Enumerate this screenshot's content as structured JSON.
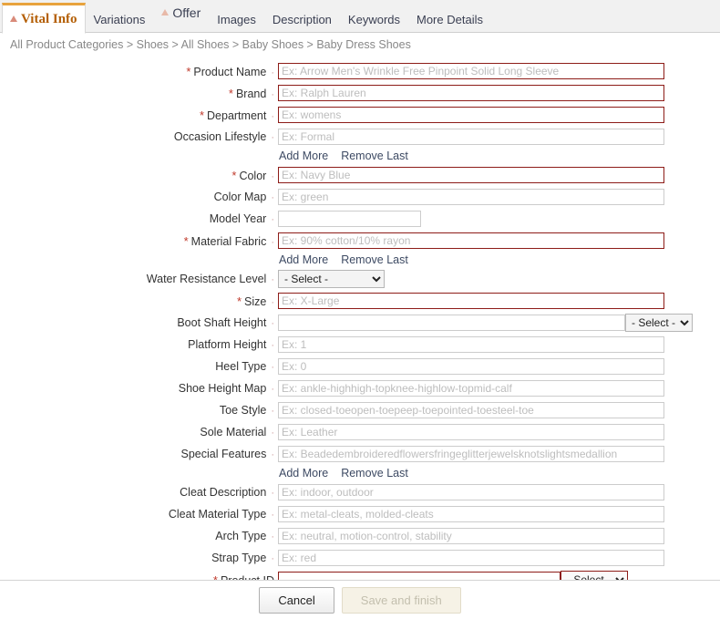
{
  "tabs": [
    {
      "label": "Vital Info",
      "active": true,
      "warning": true
    },
    {
      "label": "Variations",
      "active": false,
      "warning": false
    },
    {
      "label": "Offer",
      "active": false,
      "warning": true,
      "raised": true
    },
    {
      "label": "Images",
      "active": false,
      "warning": false
    },
    {
      "label": "Description",
      "active": false,
      "warning": false
    },
    {
      "label": "Keywords",
      "active": false,
      "warning": false
    },
    {
      "label": "More Details",
      "active": false,
      "warning": false
    }
  ],
  "breadcrumb": "All Product Categories > Shoes > All Shoes > Baby Shoes > Baby Dress Shoes",
  "links": {
    "add_more": "Add More",
    "remove_last": "Remove Last"
  },
  "select_placeholder": "- Select -",
  "fields": {
    "product_name": {
      "label": "Product Name",
      "placeholder": "Ex: Arrow Men's Wrinkle Free Pinpoint Solid Long Sleeve",
      "required": true,
      "value": ""
    },
    "brand": {
      "label": "Brand",
      "placeholder": "Ex: Ralph Lauren",
      "required": true,
      "value": ""
    },
    "department": {
      "label": "Department",
      "placeholder": "Ex: womens",
      "required": true,
      "value": ""
    },
    "occasion_lifestyle": {
      "label": "Occasion Lifestyle",
      "placeholder": "Ex: Formal",
      "required": false,
      "value": ""
    },
    "color": {
      "label": "Color",
      "placeholder": "Ex: Navy Blue",
      "required": true,
      "value": ""
    },
    "color_map": {
      "label": "Color Map",
      "placeholder": "Ex: green",
      "required": false,
      "value": ""
    },
    "model_year": {
      "label": "Model Year",
      "placeholder": "",
      "required": false,
      "value": ""
    },
    "material_fabric": {
      "label": "Material Fabric",
      "placeholder": "Ex: 90% cotton/10% rayon",
      "required": true,
      "value": ""
    },
    "water_resistance": {
      "label": "Water Resistance Level",
      "required": false,
      "value": "- Select -"
    },
    "size": {
      "label": "Size",
      "placeholder": "Ex: X-Large",
      "required": true,
      "value": ""
    },
    "boot_shaft_height": {
      "label": "Boot Shaft Height",
      "placeholder": "",
      "required": false,
      "value": "",
      "unit": "- Select -"
    },
    "platform_height": {
      "label": "Platform Height",
      "placeholder": "Ex: 1",
      "required": false,
      "value": ""
    },
    "heel_type": {
      "label": "Heel Type",
      "placeholder": "Ex: 0",
      "required": false,
      "value": ""
    },
    "shoe_height_map": {
      "label": "Shoe Height Map",
      "placeholder": "Ex: ankle-highhigh-topknee-highlow-topmid-calf",
      "required": false,
      "value": ""
    },
    "toe_style": {
      "label": "Toe Style",
      "placeholder": "Ex: closed-toeopen-toepeep-toepointed-toesteel-toe",
      "required": false,
      "value": ""
    },
    "sole_material": {
      "label": "Sole Material",
      "placeholder": "Ex: Leather",
      "required": false,
      "value": ""
    },
    "special_features": {
      "label": "Special Features",
      "placeholder": "Ex: Beadedembroideredflowersfringeglitterjewelsknotslightsmedallion",
      "required": false,
      "value": ""
    },
    "cleat_description": {
      "label": "Cleat Description",
      "placeholder": "Ex: indoor, outdoor",
      "required": false,
      "value": ""
    },
    "cleat_material": {
      "label": "Cleat Material Type",
      "placeholder": "Ex: metal-cleats, molded-cleats",
      "required": false,
      "value": ""
    },
    "arch_type": {
      "label": "Arch Type",
      "placeholder": "Ex: neutral, motion-control, stability",
      "required": false,
      "value": ""
    },
    "strap_type": {
      "label": "Strap Type",
      "placeholder": "Ex: red",
      "required": false,
      "value": ""
    },
    "product_id": {
      "label": "Product ID",
      "placeholder": "",
      "required": true,
      "value": "",
      "unit": "- Select -"
    }
  },
  "footer": {
    "cancel": "Cancel",
    "save": "Save and finish"
  },
  "colors": {
    "required_border": "#8d1c18",
    "required_star": "#c0392b",
    "active_tab_text": "#b45f06",
    "active_tab_accent": "#e8a33d",
    "link": "#3d4a63",
    "placeholder": "#bdbdbd"
  }
}
